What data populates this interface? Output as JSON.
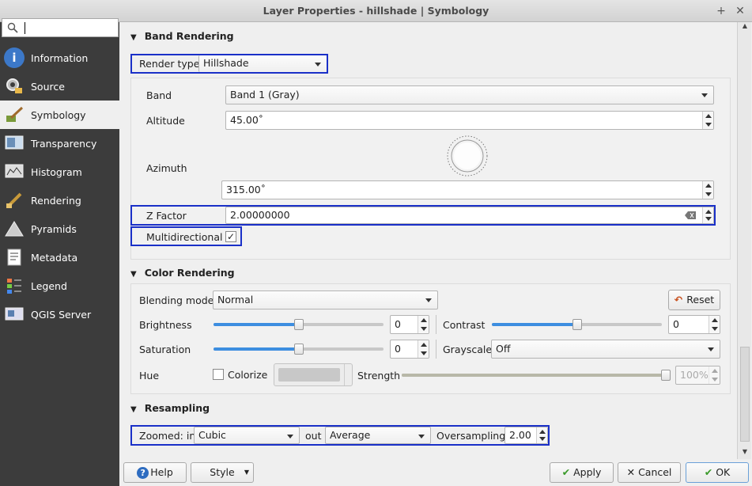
{
  "window": {
    "title": "Layer Properties - hillshade | Symbology",
    "plus": "+",
    "close": "✕"
  },
  "sidebar": {
    "search_value": "",
    "items": [
      {
        "label": "Information"
      },
      {
        "label": "Source"
      },
      {
        "label": "Symbology"
      },
      {
        "label": "Transparency"
      },
      {
        "label": "Histogram"
      },
      {
        "label": "Rendering"
      },
      {
        "label": "Pyramids"
      },
      {
        "label": "Metadata"
      },
      {
        "label": "Legend"
      },
      {
        "label": "QGIS Server"
      }
    ]
  },
  "band_rendering": {
    "title": "Band Rendering",
    "render_type_label": "Render type",
    "render_type_value": "Hillshade",
    "band_label": "Band",
    "band_value": "Band 1 (Gray)",
    "altitude_label": "Altitude",
    "altitude_value": "45.00˚",
    "azimuth_label": "Azimuth",
    "azimuth_value": "315.00˚",
    "zfactor_label": "Z Factor",
    "zfactor_value": "2.00000000",
    "multidirectional_label": "Multidirectional",
    "multidirectional_checked": "✓"
  },
  "color_rendering": {
    "title": "Color Rendering",
    "blending_label": "Blending mode",
    "blending_value": "Normal",
    "reset_label": "Reset",
    "brightness_label": "Brightness",
    "brightness_value": "0",
    "contrast_label": "Contrast",
    "contrast_value": "0",
    "saturation_label": "Saturation",
    "saturation_value": "0",
    "grayscale_label": "Grayscale",
    "grayscale_value": "Off",
    "hue_label": "Hue",
    "colorize_label": "Colorize",
    "strength_label": "Strength",
    "strength_value": "100%",
    "brightness_level": 0.5,
    "contrast_level": 0.5,
    "saturation_level": 0.5,
    "strength_level": 1.0
  },
  "resampling": {
    "title": "Resampling",
    "zoomed_in_label": "Zoomed: in",
    "zoomed_in_value": "Cubic",
    "out_label": "out",
    "out_value": "Average",
    "oversampling_label": "Oversampling",
    "oversampling_value": "2.00"
  },
  "buttons": {
    "help": "Help",
    "style": "Style",
    "apply": "Apply",
    "cancel": "Cancel",
    "ok": "OK"
  }
}
